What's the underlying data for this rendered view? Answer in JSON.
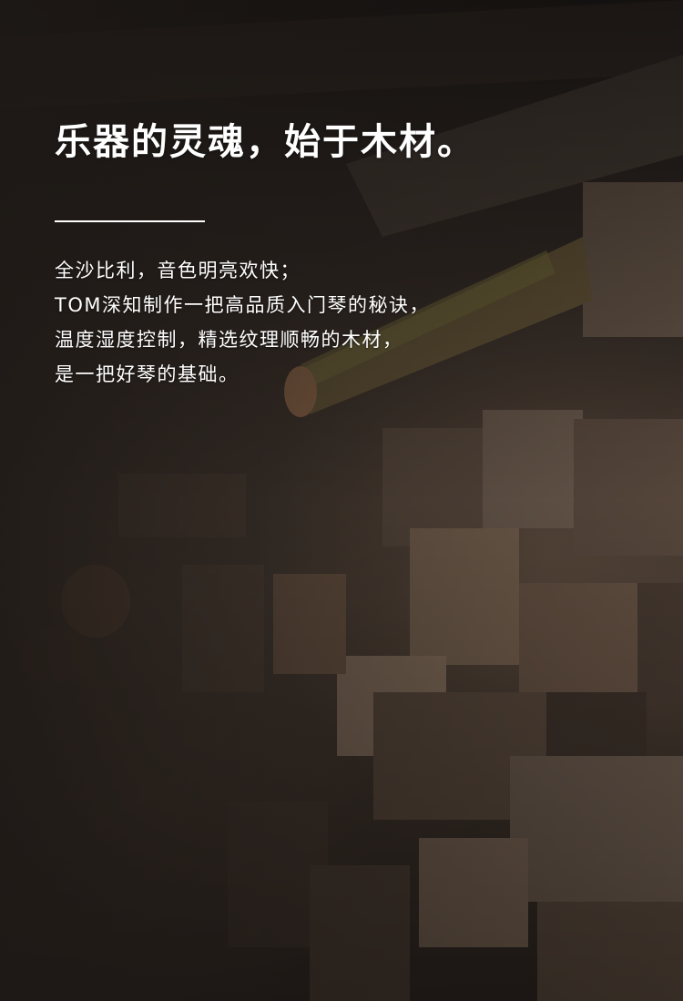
{
  "heading": "乐器的灵魂，始于木材。",
  "body_lines": [
    "全沙比利，音色明亮欢快；",
    "TOM深知制作一把高品质入门琴的秘诀，",
    "温度湿度控制，精选纹理顺畅的木材，",
    "是一把好琴的基础。"
  ],
  "colors": {
    "text": "#ffffff",
    "wood_dark": "#2b2522",
    "wood_light": "#9c7a5c"
  }
}
